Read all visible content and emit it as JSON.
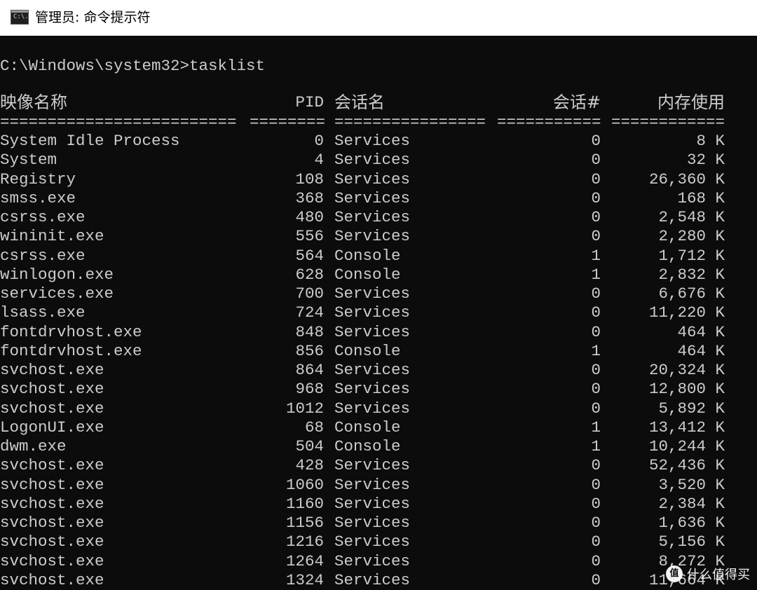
{
  "window": {
    "title": "管理员: 命令提示符",
    "icon_text": "C:\\."
  },
  "prompt": "C:\\Windows\\system32>tasklist",
  "headers": {
    "image_name": "映像名称",
    "pid": "PID",
    "session_name": "会话名",
    "session_num": "会话#",
    "mem_usage": "内存使用"
  },
  "separators": {
    "name": "=========================",
    "pid": "========",
    "session": "================",
    "num": "===========",
    "mem": "============"
  },
  "rows": [
    {
      "name": "System Idle Process",
      "pid": "0",
      "session": "Services",
      "num": "0",
      "mem": "8 K"
    },
    {
      "name": "System",
      "pid": "4",
      "session": "Services",
      "num": "0",
      "mem": "32 K"
    },
    {
      "name": "Registry",
      "pid": "108",
      "session": "Services",
      "num": "0",
      "mem": "26,360 K"
    },
    {
      "name": "smss.exe",
      "pid": "368",
      "session": "Services",
      "num": "0",
      "mem": "168 K"
    },
    {
      "name": "csrss.exe",
      "pid": "480",
      "session": "Services",
      "num": "0",
      "mem": "2,548 K"
    },
    {
      "name": "wininit.exe",
      "pid": "556",
      "session": "Services",
      "num": "0",
      "mem": "2,280 K"
    },
    {
      "name": "csrss.exe",
      "pid": "564",
      "session": "Console",
      "num": "1",
      "mem": "1,712 K"
    },
    {
      "name": "winlogon.exe",
      "pid": "628",
      "session": "Console",
      "num": "1",
      "mem": "2,832 K"
    },
    {
      "name": "services.exe",
      "pid": "700",
      "session": "Services",
      "num": "0",
      "mem": "6,676 K"
    },
    {
      "name": "lsass.exe",
      "pid": "724",
      "session": "Services",
      "num": "0",
      "mem": "11,220 K"
    },
    {
      "name": "fontdrvhost.exe",
      "pid": "848",
      "session": "Services",
      "num": "0",
      "mem": "464 K"
    },
    {
      "name": "fontdrvhost.exe",
      "pid": "856",
      "session": "Console",
      "num": "1",
      "mem": "464 K"
    },
    {
      "name": "svchost.exe",
      "pid": "864",
      "session": "Services",
      "num": "0",
      "mem": "20,324 K"
    },
    {
      "name": "svchost.exe",
      "pid": "968",
      "session": "Services",
      "num": "0",
      "mem": "12,800 K"
    },
    {
      "name": "svchost.exe",
      "pid": "1012",
      "session": "Services",
      "num": "0",
      "mem": "5,892 K"
    },
    {
      "name": "LogonUI.exe",
      "pid": "68",
      "session": "Console",
      "num": "1",
      "mem": "13,412 K"
    },
    {
      "name": "dwm.exe",
      "pid": "504",
      "session": "Console",
      "num": "1",
      "mem": "10,244 K"
    },
    {
      "name": "svchost.exe",
      "pid": "428",
      "session": "Services",
      "num": "0",
      "mem": "52,436 K"
    },
    {
      "name": "svchost.exe",
      "pid": "1060",
      "session": "Services",
      "num": "0",
      "mem": "3,520 K"
    },
    {
      "name": "svchost.exe",
      "pid": "1160",
      "session": "Services",
      "num": "0",
      "mem": "2,384 K"
    },
    {
      "name": "svchost.exe",
      "pid": "1156",
      "session": "Services",
      "num": "0",
      "mem": "1,636 K"
    },
    {
      "name": "svchost.exe",
      "pid": "1216",
      "session": "Services",
      "num": "0",
      "mem": "5,156 K"
    },
    {
      "name": "svchost.exe",
      "pid": "1264",
      "session": "Services",
      "num": "0",
      "mem": "8,272 K"
    },
    {
      "name": "svchost.exe",
      "pid": "1324",
      "session": "Services",
      "num": "0",
      "mem": "11,664 K"
    }
  ],
  "watermark": {
    "logo": "值",
    "text": "什么值得买"
  },
  "colors": {
    "console_bg": "#0c0c0c",
    "console_fg": "#cccccc",
    "titlebar_bg": "#ffffff"
  }
}
